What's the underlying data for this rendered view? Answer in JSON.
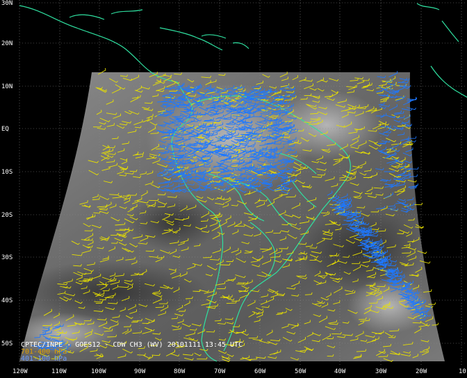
{
  "map": {
    "lat_labels": [
      "30N",
      "20N",
      "10N",
      "EQ",
      "10S",
      "20S",
      "30S",
      "40S",
      "50S"
    ],
    "lon_labels": [
      "120W",
      "110W",
      "100W",
      "90W",
      "80W",
      "70W",
      "60W",
      "50W",
      "40W",
      "30W",
      "20W",
      "10"
    ],
    "caption": {
      "product": "CPTEC/INPE - GOES12 - CDW CH3 (WV) 20101111 13:45 UTC",
      "legend_low": "701-400 hPa",
      "legend_high": "401-100 hPa"
    },
    "colors": {
      "background": "#000000",
      "coastline": "#2fe0a0",
      "grid": "#8a8a8a",
      "wind_low": "#e8e000",
      "wind_high": "#1e78ff",
      "legend_low_text": "#e0a000",
      "legend_high_text": "#6a9cff"
    }
  }
}
